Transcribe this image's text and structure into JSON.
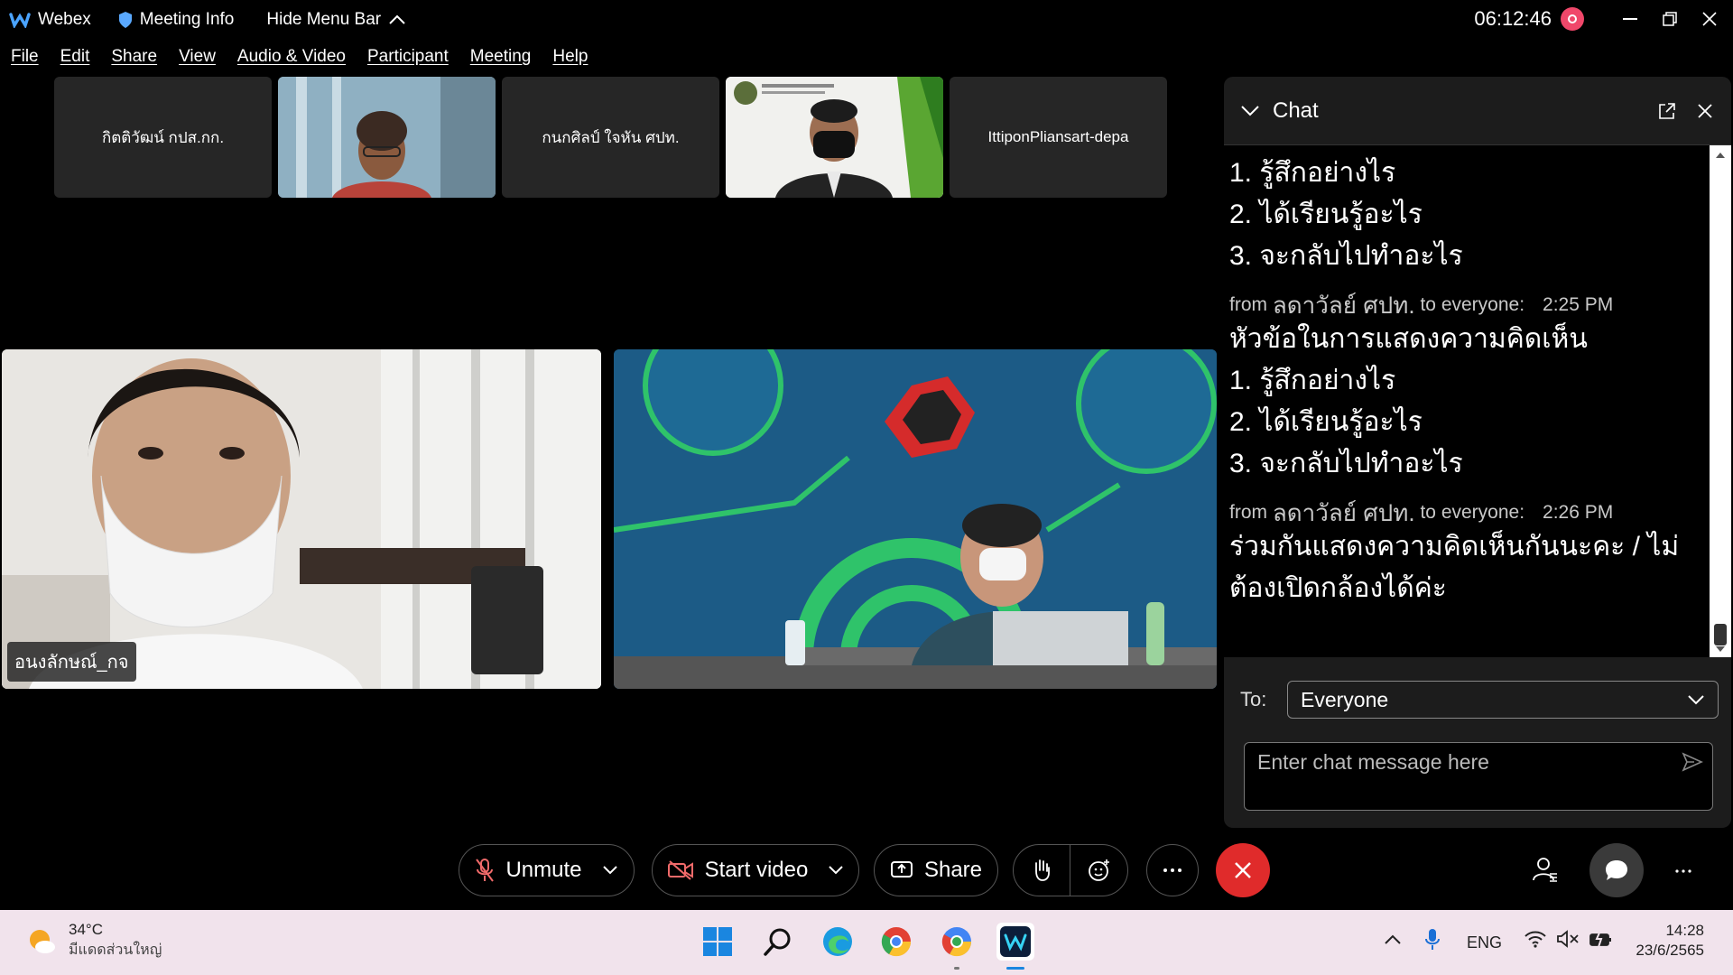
{
  "titlebar": {
    "app_name": "Webex",
    "meeting_info": "Meeting Info",
    "hide_menu_bar": "Hide Menu Bar",
    "timer": "06:12:46"
  },
  "menu": [
    "File",
    "Edit",
    "Share",
    "View",
    "Audio & Video",
    "Participant",
    "Meeting",
    "Help"
  ],
  "thumbnails": [
    {
      "name": "กิตติวัฒน์ กปส.กก."
    },
    {
      "name": ""
    },
    {
      "name": "กนกศิลป์ ใจหัน ศปท."
    },
    {
      "name": ""
    },
    {
      "name": "IttiponPliansart-depa"
    }
  ],
  "main_video": {
    "left_name": "อนงลักษณ์_กจ"
  },
  "chat": {
    "title": "Chat",
    "messages_top": [
      "1. รู้สึกอย่างไร",
      "2. ได้เรียนรู้อะไร",
      "3. จะกลับไปทำอะไร"
    ],
    "message1": {
      "from_prefix": "from",
      "sender": "ลดาวัลย์ ศปท.",
      "to": "to everyone:",
      "time": "2:25 PM",
      "lines": [
        "หัวข้อในการแสดงความคิดเห็น",
        "1. รู้สึกอย่างไร",
        "2. ได้เรียนรู้อะไร",
        "3. จะกลับไปทำอะไร"
      ]
    },
    "message2": {
      "from_prefix": "from",
      "sender": "ลดาวัลย์ ศปท.",
      "to": "to everyone:",
      "time": "2:26 PM",
      "lines": [
        "ร่วมกันแสดงความคิดเห็นกันนะคะ /  ไม่",
        "ต้องเปิดกล้องได้ค่ะ"
      ]
    },
    "to_label": "To:",
    "to_value": "Everyone",
    "input_placeholder": "Enter chat message here"
  },
  "controls": {
    "unmute": "Unmute",
    "start_video": "Start video",
    "share": "Share"
  },
  "taskbar": {
    "weather_temp": "34°C",
    "weather_desc": "มีแดดส่วนใหญ่",
    "language": "ENG",
    "clock_time": "14:28",
    "clock_date": "23/6/2565"
  },
  "colors": {
    "accent_red": "#e02b2b",
    "record_pink": "#f0476a",
    "chat_bg": "#1c1c1c",
    "taskbar_bg": "#f1e3ec"
  }
}
